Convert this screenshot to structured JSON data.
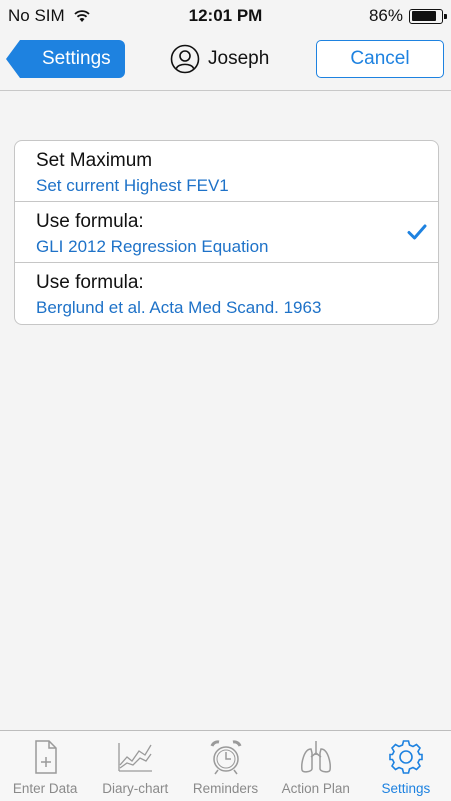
{
  "status_bar": {
    "carrier": "No SIM",
    "time": "12:01 PM",
    "battery": "86%",
    "battery_level": 0.86
  },
  "nav": {
    "back_label": "Settings",
    "user_name": "Joseph",
    "cancel_label": "Cancel"
  },
  "options": [
    {
      "title": "Set Maximum",
      "subtitle": "Set current Highest FEV1",
      "selected": false
    },
    {
      "title": "Use formula:",
      "subtitle": "GLI 2012 Regression Equation",
      "selected": true
    },
    {
      "title": "Use formula:",
      "subtitle": "Berglund et al. Acta Med Scand. 1963",
      "selected": false
    }
  ],
  "tabs": [
    {
      "label": "Enter Data",
      "icon": "enter-data-icon"
    },
    {
      "label": "Diary-chart",
      "icon": "diary-chart-icon"
    },
    {
      "label": "Reminders",
      "icon": "alarm-clock-icon"
    },
    {
      "label": "Action Plan",
      "icon": "lungs-icon"
    },
    {
      "label": "Settings",
      "icon": "gear-icon"
    }
  ],
  "active_tab": "Settings",
  "colors": {
    "accent": "#1e82e0",
    "subtitle": "#1e72c8"
  }
}
